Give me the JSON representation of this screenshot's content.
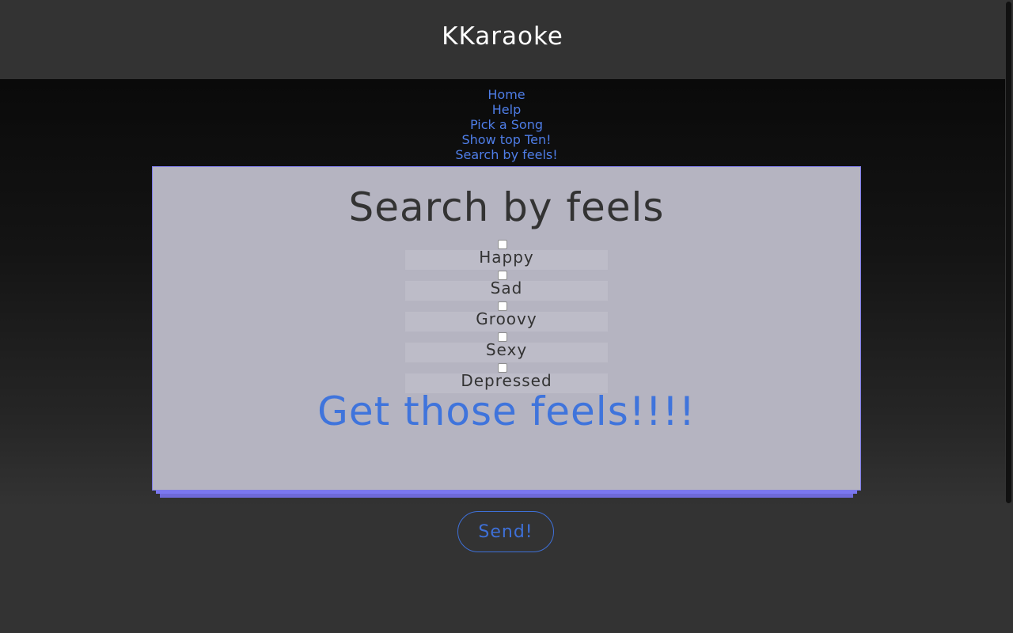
{
  "header": {
    "title": "KKaraoke"
  },
  "nav": {
    "items": [
      {
        "label": "Home"
      },
      {
        "label": "Help"
      },
      {
        "label": "Pick a Song"
      },
      {
        "label": "Show top Ten!"
      },
      {
        "label": "Search by feels!"
      }
    ]
  },
  "card": {
    "title": "Search by feels",
    "feels": [
      {
        "label": "Happy",
        "checked": false
      },
      {
        "label": "Sad",
        "checked": false
      },
      {
        "label": "Groovy",
        "checked": false
      },
      {
        "label": "Sexy",
        "checked": false
      },
      {
        "label": "Depressed",
        "checked": false
      }
    ],
    "result_text": "Get those feels!!!!"
  },
  "send_label": "Send!",
  "colors": {
    "background": "#333333",
    "link": "#4f7ee8",
    "card": "#b5b4c1",
    "card_border": "#7d7be8",
    "accent": "#3e70d8"
  }
}
